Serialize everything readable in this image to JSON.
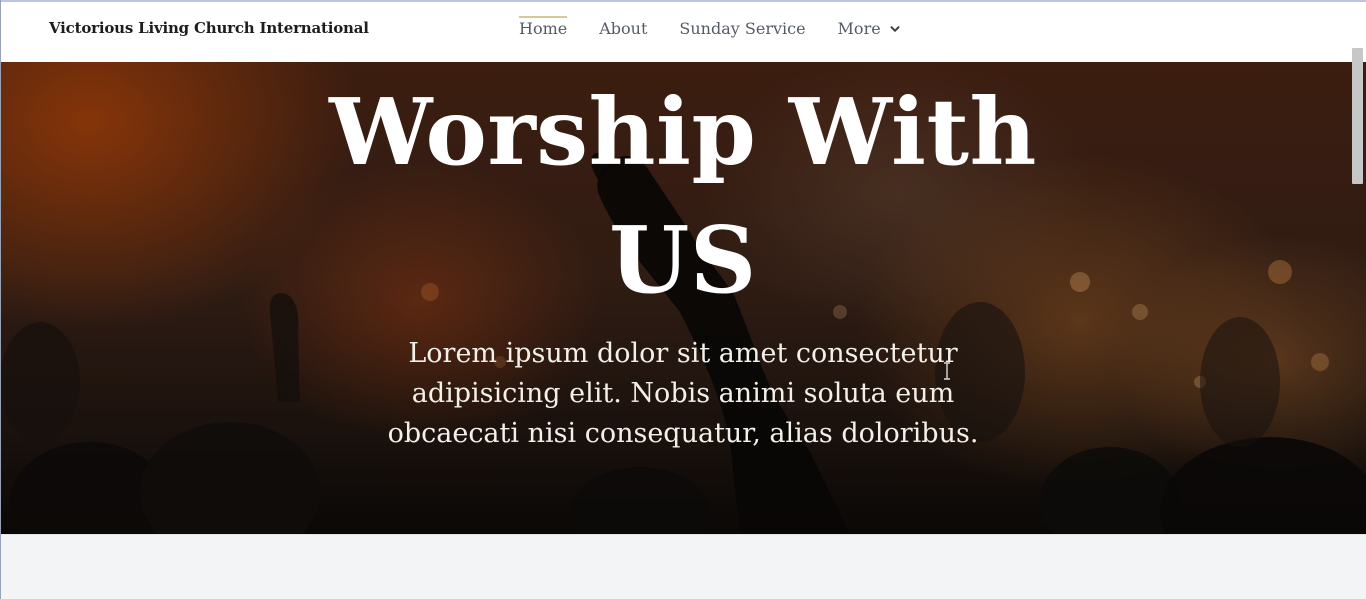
{
  "navbar": {
    "brand": "Victorious Living Church International",
    "items": [
      {
        "label": "Home",
        "active": true
      },
      {
        "label": "About",
        "active": false
      },
      {
        "label": "Sunday Service",
        "active": false
      },
      {
        "label": "More",
        "active": false,
        "icon": "chevron-down-icon"
      }
    ]
  },
  "hero": {
    "title_line1": "Worship With",
    "title_line2": "US",
    "body": "Lorem ipsum dolor sit amet consectetur adipisicing elit. Nobis animi soluta eum obcaecati nisi consequatur, alias doloribus.",
    "background_image": "worship-crowd-raised-hand"
  },
  "colors": {
    "accent_underline": "#d9c79a",
    "nav_text": "#555b66",
    "brand_text": "#1d1d1d",
    "section_bg": "#f3f4f6"
  },
  "icons": {
    "cursor": "text-cursor-icon"
  }
}
